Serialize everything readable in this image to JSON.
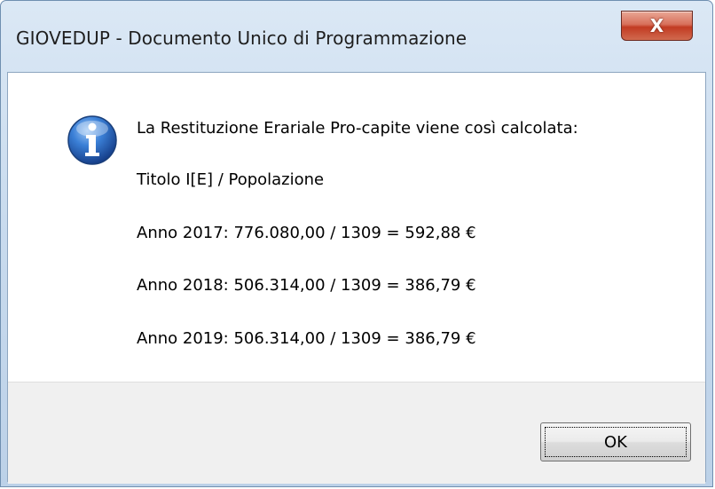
{
  "window": {
    "title": "GIOVEDUP - Documento Unico di Programmazione",
    "close_glyph": "X"
  },
  "dialog": {
    "icon": "info-icon",
    "lines": [
      "La Restituzione Erariale Pro-capite viene così calcolata:",
      "Titolo I[E] / Popolazione",
      "Anno 2017: 776.080,00 / 1309 = 592,88 €",
      "Anno 2018: 506.314,00 / 1309 = 386,79 €",
      "Anno 2019: 506.314,00 / 1309 = 386,79 €"
    ],
    "ok_label": "OK"
  },
  "colors": {
    "titlebar": "#c9dbee",
    "close_button": "#c23b22",
    "info_icon": "#1f5fbf",
    "footer": "#f0f0f0"
  }
}
